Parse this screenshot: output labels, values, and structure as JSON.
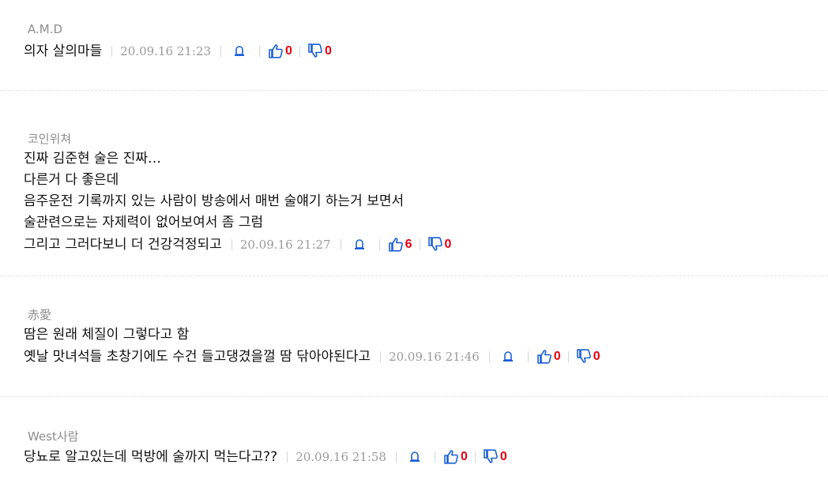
{
  "comments": [
    {
      "author": "A.M.D",
      "lines": [
        "의자 살의마들"
      ],
      "date": "20.09.16 21:23",
      "likes": "0",
      "dislikes": "0"
    },
    {
      "author": "코인위쳐",
      "lines": [
        "진짜 김준현 술은 진짜…",
        "다른거 다 좋은데",
        "음주운전 기록까지 있는 사람이 방송에서 매번 술얘기 하는거 보면서",
        "술관련으로는 자제력이 없어보여서 좀 그럼",
        "그리고 그러다보니 더 건강걱정되고"
      ],
      "date": "20.09.16 21:27",
      "likes": "6",
      "dislikes": "0"
    },
    {
      "author": "赤愛",
      "lines": [
        "땀은 원래 체질이 그렇다고 함",
        "옛날 맛녀석들 초창기에도 수건 들고댕겼을껄 땀 닦아야된다고"
      ],
      "date": "20.09.16 21:46",
      "likes": "0",
      "dislikes": "0"
    },
    {
      "author": "West사람",
      "lines": [
        "당뇨로 알고있는데 먹방에 술까지 먹는다고??"
      ],
      "date": "20.09.16 21:58",
      "likes": "0",
      "dislikes": "0"
    }
  ],
  "colors": {
    "count": "#e60012",
    "icon": "#1a5fd6",
    "author": "#8d8d8d",
    "date": "#9a9a9a"
  },
  "icons": {
    "report": "siren-icon",
    "like": "thumbs-up-icon",
    "dislike": "thumbs-down-icon"
  }
}
